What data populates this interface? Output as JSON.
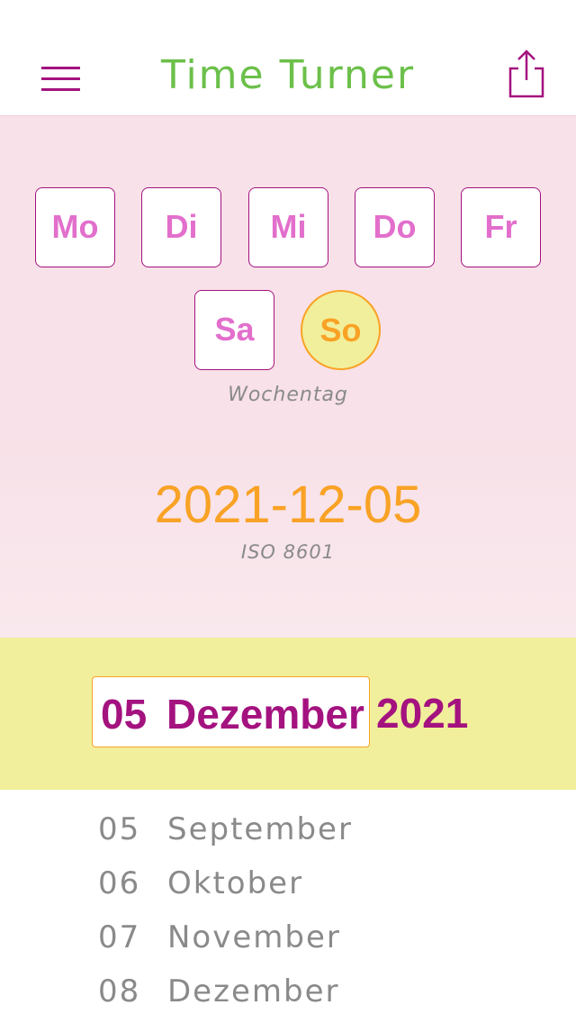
{
  "header": {
    "title": "Time Turner",
    "menu_icon": "hamburger-menu-icon",
    "share_icon": "share-icon",
    "title_color": "#6cc04a",
    "accent_color": "#a4127f"
  },
  "weekdays": {
    "days": [
      "Mo",
      "Di",
      "Mi",
      "Do",
      "Fr",
      "Sa",
      "So"
    ],
    "selected": "So",
    "caption": "Wochentag"
  },
  "iso": {
    "date": "2021-12-05",
    "caption": "ISO 8601"
  },
  "date_bar": {
    "day": "05",
    "month": "Dezember",
    "year": "2021"
  },
  "picker": {
    "rows": [
      {
        "day": "05",
        "month": "September"
      },
      {
        "day": "06",
        "month": "Oktober"
      },
      {
        "day": "07",
        "month": "November"
      },
      {
        "day": "08",
        "month": "Dezember"
      }
    ]
  },
  "colors": {
    "pink_bg": "#f8e1e8",
    "yellow_bg": "#f1ef9c",
    "orange": "#f9a225",
    "day_text": "#e26fcc"
  }
}
